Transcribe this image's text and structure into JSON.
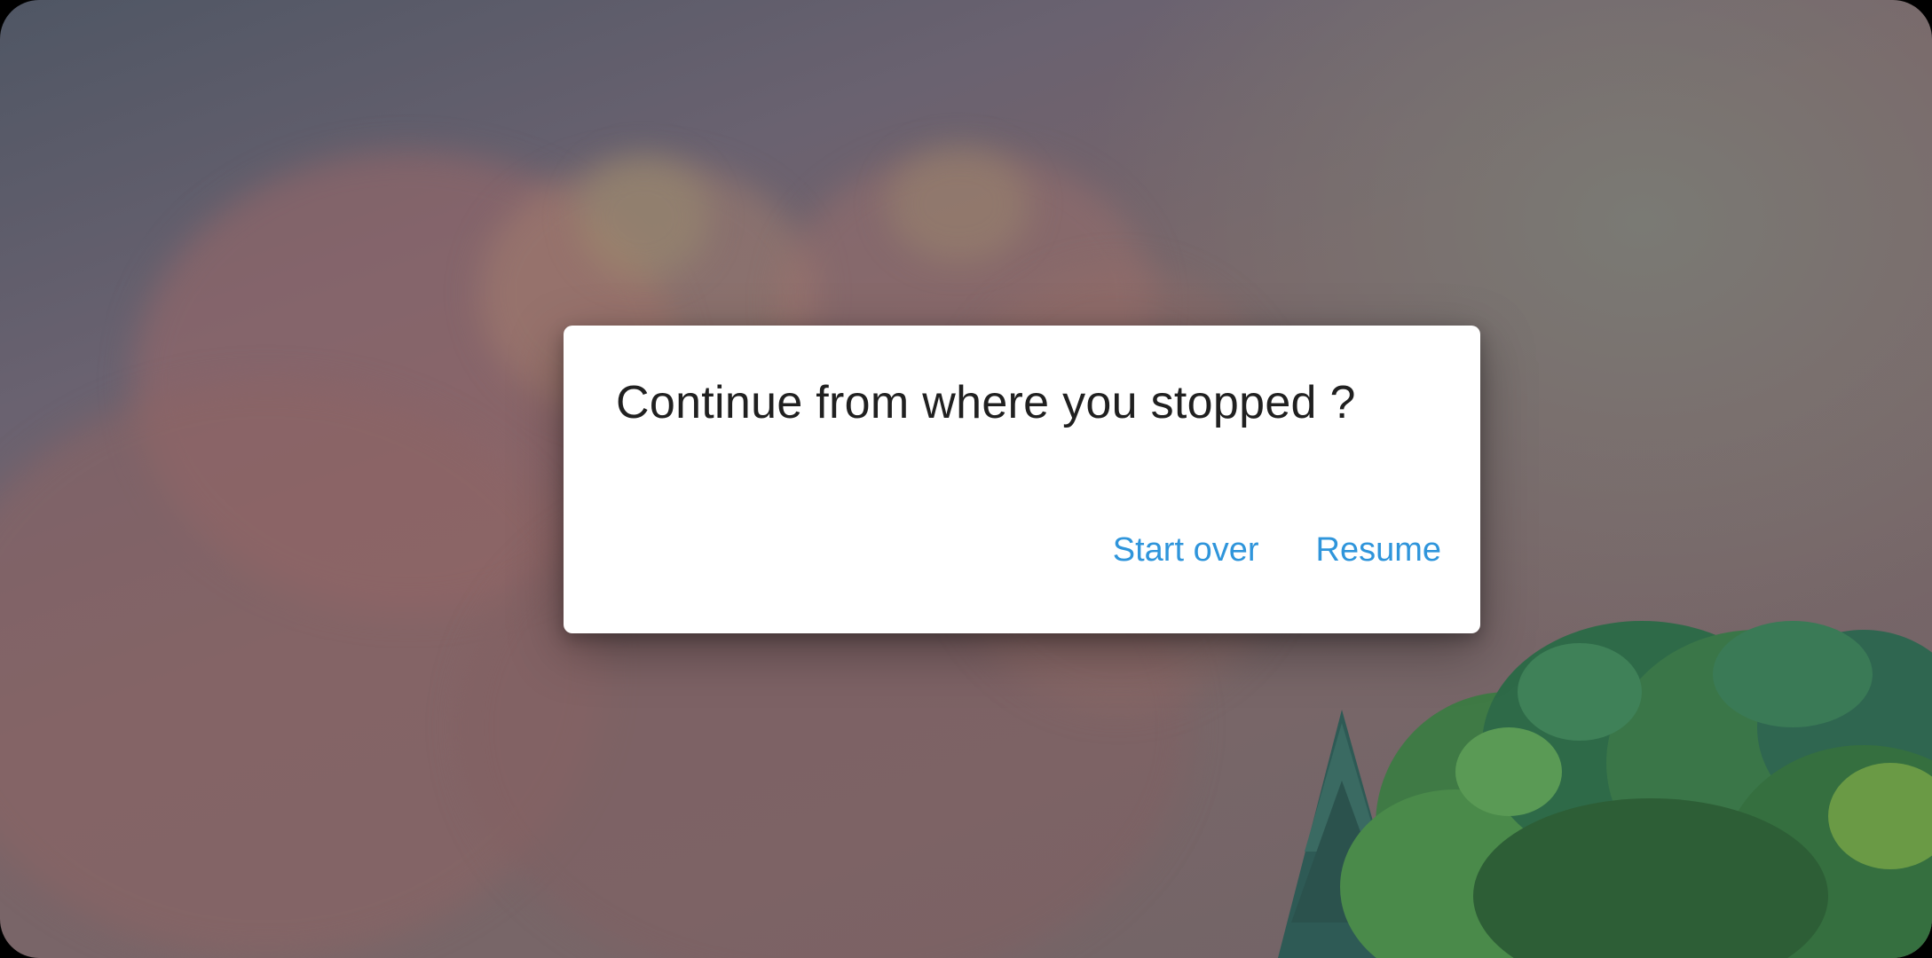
{
  "dialog": {
    "title": "Continue from where you stopped ?",
    "start_over_label": "Start over",
    "resume_label": "Resume"
  },
  "colors": {
    "accent": "#2f95db",
    "dialog_background": "#ffffff",
    "title_text": "#202020"
  }
}
